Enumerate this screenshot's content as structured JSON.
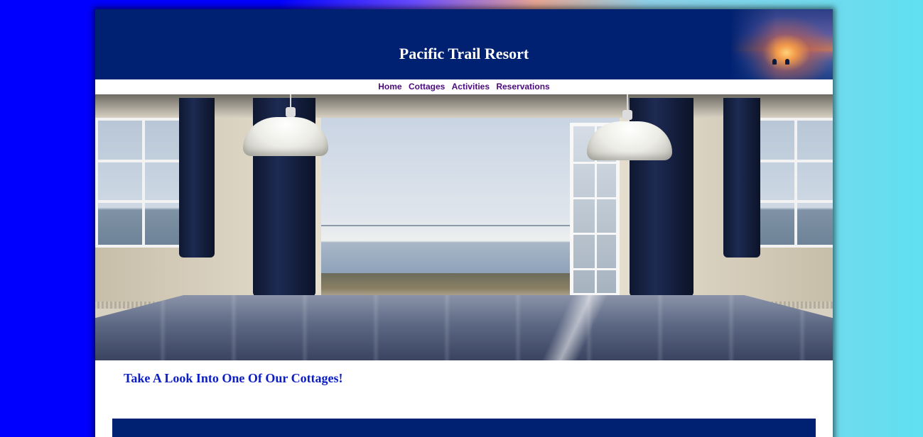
{
  "header": {
    "title": "Pacific Trail Resort"
  },
  "nav": {
    "items": [
      {
        "label": "Home"
      },
      {
        "label": "Cottages"
      },
      {
        "label": "Activities"
      },
      {
        "label": "Reservations"
      }
    ]
  },
  "main": {
    "tagline": "Take A Look Into One Of Our Cottages!"
  },
  "colors": {
    "header_bg": "#002171",
    "nav_link": "#4b0a7d",
    "tagline": "#0b1ec6"
  }
}
